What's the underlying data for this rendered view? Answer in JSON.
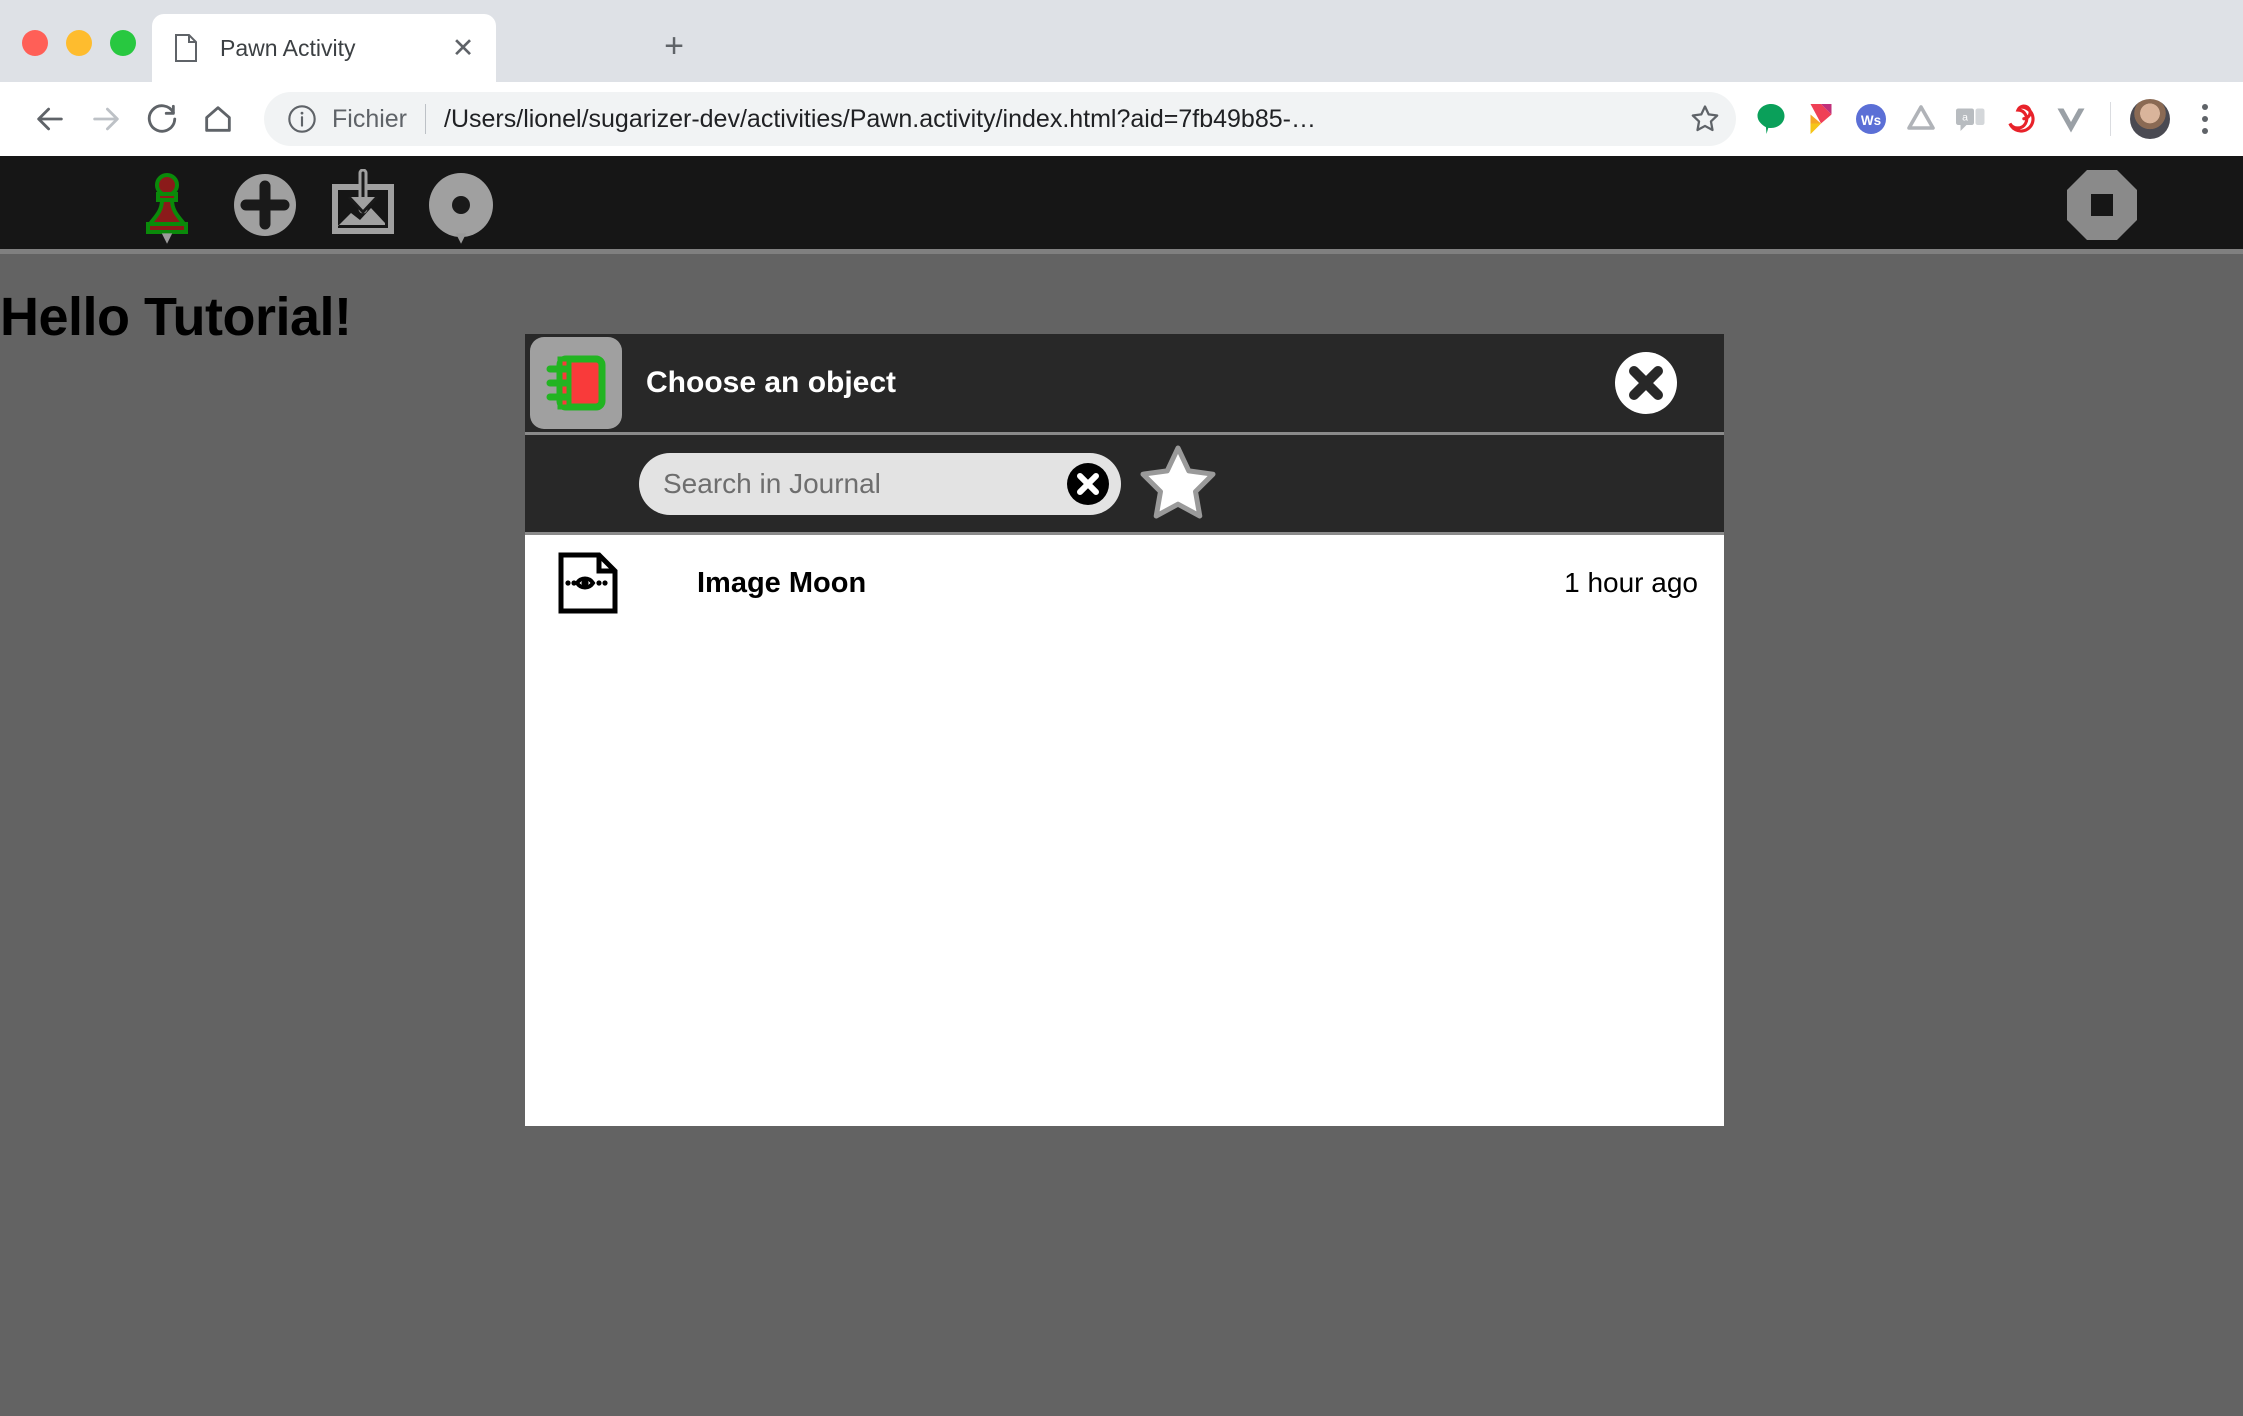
{
  "browser": {
    "tab": {
      "title": "Pawn Activity",
      "favicon": "page-icon",
      "close_label": "✕"
    },
    "new_tab_label": "+",
    "nav": {
      "back": "←",
      "forward": "→",
      "reload": "⟳",
      "home": "⌂"
    },
    "omnibox": {
      "scheme_label": "Fichier",
      "url": "/Users/lionel/sugarizer-dev/activities/Pawn.activity/index.html?aid=7fb49b85-…",
      "info_icon": "info-circle-icon",
      "bookmark_icon": "star-outline-icon"
    },
    "extensions": [
      {
        "name": "green-balloon-extension",
        "color": "#0aa05a"
      },
      {
        "name": "pocket-extension",
        "color": "#ef4056"
      },
      {
        "name": "wikiwand-extension",
        "color": "#5b6fd6"
      },
      {
        "name": "google-drive-extension",
        "color": "#b0b3b8"
      },
      {
        "name": "grammar-chat-extension",
        "color": "#b8bcc0"
      },
      {
        "name": "red-spiral-extension",
        "color": "#e8222a"
      },
      {
        "name": "vue-devtools-extension",
        "color": "#9aa0a6"
      }
    ],
    "profile_avatar": "user-avatar",
    "menu_icon": "three-dots-menu-icon"
  },
  "sugar_toolbar": {
    "items": [
      {
        "name": "activity-pawn-icon",
        "label": "Pawn Activity",
        "has_caret": true,
        "fill": "#8b1a1a",
        "stroke": "#0a8a0a"
      },
      {
        "name": "add-item-icon",
        "label": "Add",
        "has_caret": false
      },
      {
        "name": "insert-image-icon",
        "label": "Insert image",
        "has_caret": false
      },
      {
        "name": "record-icon",
        "label": "Record",
        "has_caret": true
      }
    ],
    "stop_button": {
      "name": "stop-activity-icon",
      "label": "Stop"
    }
  },
  "page": {
    "heading": "Hello Tutorial!"
  },
  "dialog": {
    "icon": "journal-icon",
    "title": "Choose an object",
    "close_label": "✕",
    "search": {
      "placeholder": "Search in Journal",
      "value": "",
      "clear_icon": "clear-search-icon",
      "favorite_icon": "favorite-star-icon"
    },
    "list": {
      "rows": [
        {
          "icon": "image-viewer-document-icon",
          "title": "Image Moon",
          "time": "1 hour ago"
        }
      ]
    }
  },
  "colors": {
    "toolbar_bg": "#161616",
    "page_bg": "#636363",
    "dialog_header_bg": "#282828",
    "dialog_body_bg": "#ffffff",
    "journal_green": "#22b422",
    "journal_red": "#f93a3a"
  }
}
